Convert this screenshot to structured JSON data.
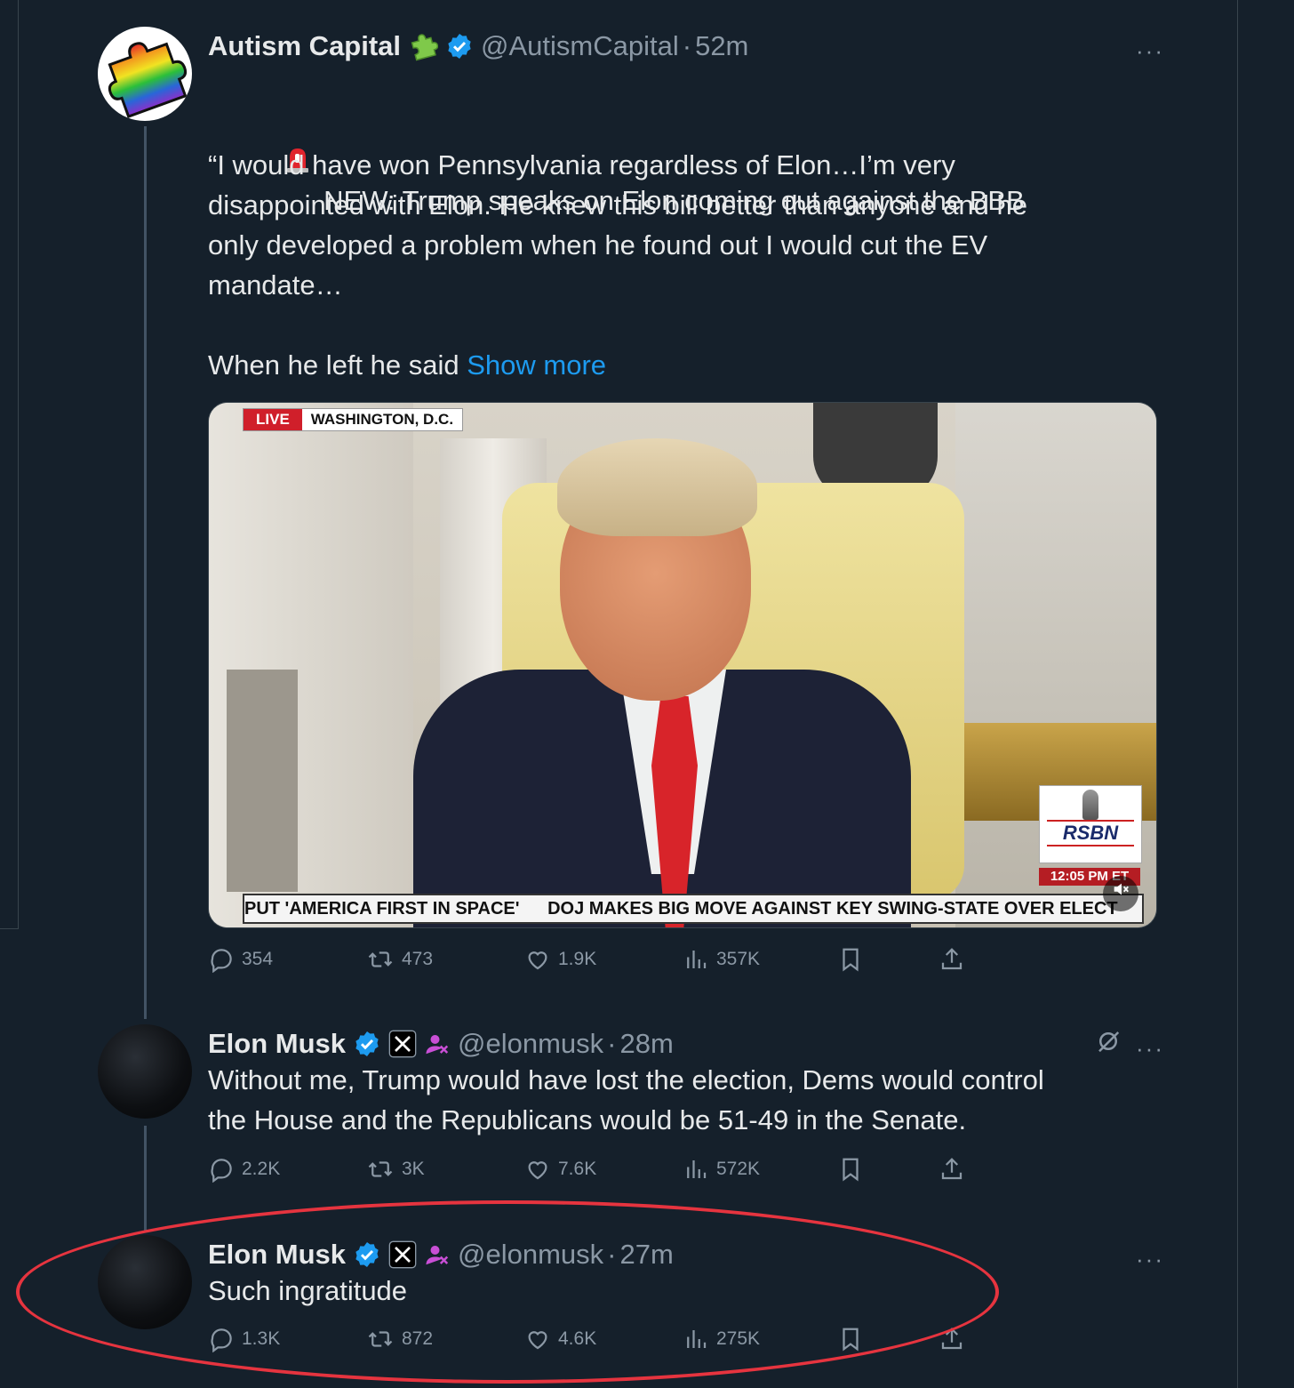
{
  "tweets": [
    {
      "name": "Autism Capital",
      "handle": "@AutismCapital",
      "time": "52m",
      "body_line1": "NEW: Trump speaks on Elon coming out against the BBB",
      "body_quote": "“I would have won Pennsylvania regardless of Elon…I’m very\ndisappointed with Elon. He knew this bill better than anyone and he\nonly developed a problem when he found out I would cut the EV\nmandate…",
      "body_tail": "When he left he said ",
      "show_more": "Show more",
      "stats": {
        "replies": "354",
        "reposts": "473",
        "likes": "1.9K",
        "views": "357K"
      },
      "media": {
        "live_label": "LIVE",
        "location": "WASHINGTON, D.C.",
        "network": "RSBN",
        "clock": "12:05 PM ET",
        "ticker_1": "PUT 'AMERICA FIRST IN SPACE'",
        "ticker_2": "DOJ MAKES BIG MOVE AGAINST KEY SWING-STATE OVER ELECT"
      }
    },
    {
      "name": "Elon Musk",
      "handle": "@elonmusk",
      "time": "28m",
      "body": "Without me, Trump would have lost the election, Dems would control\nthe House and the Republicans would be 51-49 in the Senate.",
      "stats": {
        "replies": "2.2K",
        "reposts": "3K",
        "likes": "7.6K",
        "views": "572K"
      }
    },
    {
      "name": "Elon Musk",
      "handle": "@elonmusk",
      "time": "27m",
      "body": "Such ingratitude",
      "stats": {
        "replies": "1.3K",
        "reposts": "872",
        "likes": "4.6K",
        "views": "275K"
      }
    }
  ],
  "separator": "·",
  "more_glyph": "···",
  "colors": {
    "background": "#15202b",
    "link": "#1d9bf0",
    "verified": "#1d9bf0",
    "highlight": "#e6343f",
    "muted": "#8b98a5"
  },
  "icons": [
    "alarm-emoji-icon",
    "puzzle-emoji-icon",
    "verified-badge-icon",
    "x-logo-badge-icon",
    "affiliate-icon",
    "grok-icon",
    "reply-icon",
    "repost-icon",
    "like-icon",
    "views-icon",
    "bookmark-icon",
    "share-icon",
    "more-icon",
    "mute-icon"
  ]
}
